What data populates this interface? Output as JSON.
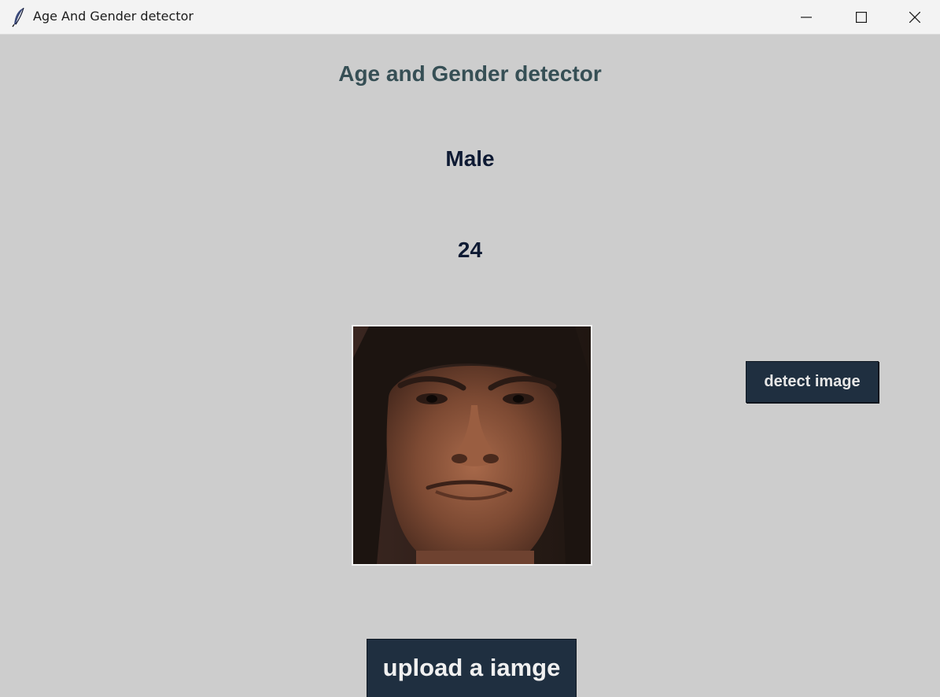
{
  "window": {
    "title": "Age And Gender detector",
    "icon": "feather-icon",
    "controls": [
      "minimize-icon",
      "maximize-icon",
      "close-icon"
    ]
  },
  "main": {
    "heading": "Age and Gender detector",
    "gender_result": "Male",
    "age_result": "24",
    "photo": "face-portrait",
    "detect_button_label": "detect image",
    "upload_button_label": "upload a iamge"
  },
  "colors": {
    "background": "#cdcdcd",
    "heading": "#364f55",
    "result_text": "#0e1a33",
    "button_bg": "#1f2f40",
    "button_text": "#e6e6e6"
  }
}
